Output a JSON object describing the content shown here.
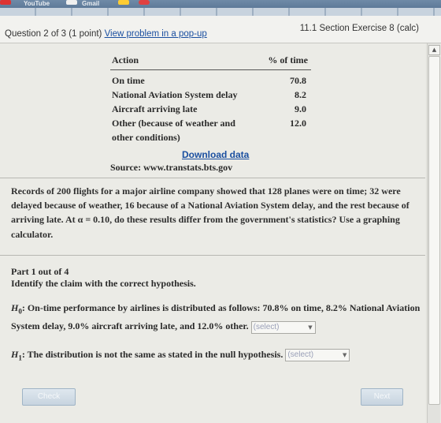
{
  "browser": {
    "tab_fragments": [
      "YouTube",
      "Gmail"
    ],
    "icon_colors": [
      "#ffcc33",
      "#e04040",
      "#f0f0f0"
    ]
  },
  "header": {
    "question_label": "Question 2 of 3 (1 point)",
    "popup_link": "View problem in a pop-up",
    "section_label": "11.1 Section Exercise 8 (calc)"
  },
  "table": {
    "col_action": "Action",
    "col_pct": "% of time",
    "rows": [
      {
        "action_lines": [
          "On time"
        ],
        "pct": "70.8"
      },
      {
        "action_lines": [
          "National Aviation System delay"
        ],
        "pct": "8.2"
      },
      {
        "action_lines": [
          "Aircraft arriving late"
        ],
        "pct": "9.0"
      },
      {
        "action_lines": [
          "Other (because of weather and",
          "other conditions)"
        ],
        "pct": "12.0"
      }
    ]
  },
  "download_link": "Download data",
  "source": "Source: www.transtats.bts.gov",
  "problem_text": "Records of 200 flights for a major airline company showed that 128 planes were on time; 32 were delayed because of weather, 16 because of a National Aviation System delay, and the rest because of arriving late. At α = 0.10, do these results differ from the government's statistics? Use a graphing calculator.",
  "part": {
    "heading": "Part 1 out of 4",
    "instruction": "Identify the claim with the correct hypothesis."
  },
  "h0": {
    "symbol": "H",
    "sub": "0",
    "text": ": On-time performance by airlines is distributed as follows: 70.8% on time, 8.2% National Aviation System delay, 9.0% aircraft arriving late, and 12.0% other.",
    "select_value": "(select)"
  },
  "h1": {
    "symbol": "H",
    "sub": "1",
    "text": ": The distribution is not the same as stated in the null hypothesis.",
    "select_value": "(select)"
  },
  "buttons": {
    "check": "Check",
    "next": "Next"
  }
}
